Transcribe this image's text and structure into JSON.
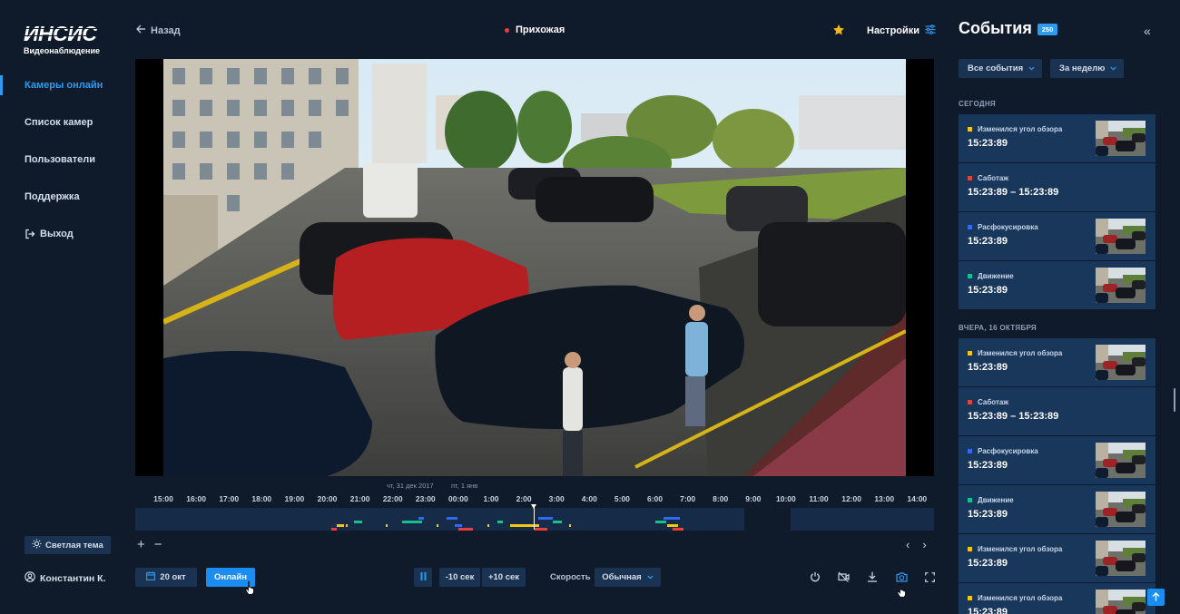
{
  "brand": {
    "logo": "ИНСИС",
    "subtitle": "Видеонаблюдение"
  },
  "sidebar": {
    "items": [
      {
        "label": "Камеры онлайн"
      },
      {
        "label": "Список камер"
      },
      {
        "label": "Пользователи"
      },
      {
        "label": "Поддержка"
      },
      {
        "label": "Выход",
        "icon": "logout-icon"
      }
    ],
    "active": "Камеры онлайн",
    "theme_button": "Светлая тема",
    "user_name": "Константин К."
  },
  "header": {
    "back_label": "Назад",
    "camera_name": "Прихожая",
    "camera_status_color": "#e8413c",
    "settings_label": "Настройки"
  },
  "timeline": {
    "date_left": "чт, 31 дек 2017",
    "date_right": "пт, 1 янв",
    "hours": [
      "15:00",
      "16:00",
      "17:00",
      "18:00",
      "19:00",
      "20:00",
      "21:00",
      "22:00",
      "23:00",
      "00:00",
      "1:00",
      "2:00",
      "3:00",
      "4:00",
      "5:00",
      "6:00",
      "7:00",
      "8:00",
      "9:00",
      "10:00",
      "11:00",
      "12:00",
      "13:00",
      "14:00"
    ]
  },
  "controls": {
    "date_button": "20 окт",
    "online_button": "Онлайн",
    "back10": "-10 сек",
    "fwd10": "+10 сек",
    "speed_label": "Скорость",
    "speed_value": "Обычная"
  },
  "events_panel": {
    "title": "События",
    "count": "250",
    "filter_type": "Все события",
    "filter_period": "За неделю",
    "groups": [
      {
        "label": "СЕГОДНЯ",
        "events": [
          {
            "type": "Изменился угол обзора",
            "time": "15:23:89",
            "color": "#f5c518",
            "thumb": true
          },
          {
            "type": "Саботаж",
            "time": "15:23:89 – 15:23:89",
            "color": "#e8413c",
            "thumb": false
          },
          {
            "type": "Расфокусировка",
            "time": "15:23:89",
            "color": "#2f6bf0",
            "thumb": true
          },
          {
            "type": "Движение",
            "time": "15:23:89",
            "color": "#17c08a",
            "thumb": true
          }
        ]
      },
      {
        "label": "ВЧЕРА, 16 ОКТЯБРЯ",
        "events": [
          {
            "type": "Изменился угол обзора",
            "time": "15:23:89",
            "color": "#f5c518",
            "thumb": true
          },
          {
            "type": "Саботаж",
            "time": "15:23:89 – 15:23:89",
            "color": "#e8413c",
            "thumb": false
          },
          {
            "type": "Расфокусировка",
            "time": "15:23:89",
            "color": "#2f6bf0",
            "thumb": true
          },
          {
            "type": "Движение",
            "time": "15:23:89",
            "color": "#17c08a",
            "thumb": true
          },
          {
            "type": "Изменился угол обзора",
            "time": "15:23:89",
            "color": "#f5c518",
            "thumb": true
          },
          {
            "type": "Изменился угол обзора",
            "time": "15:23:89",
            "color": "#f5c518",
            "thumb": true
          }
        ]
      }
    ]
  },
  "colors": {
    "accent": "#1b8cf0",
    "background": "#0f1a2b",
    "card": "#19375b"
  }
}
